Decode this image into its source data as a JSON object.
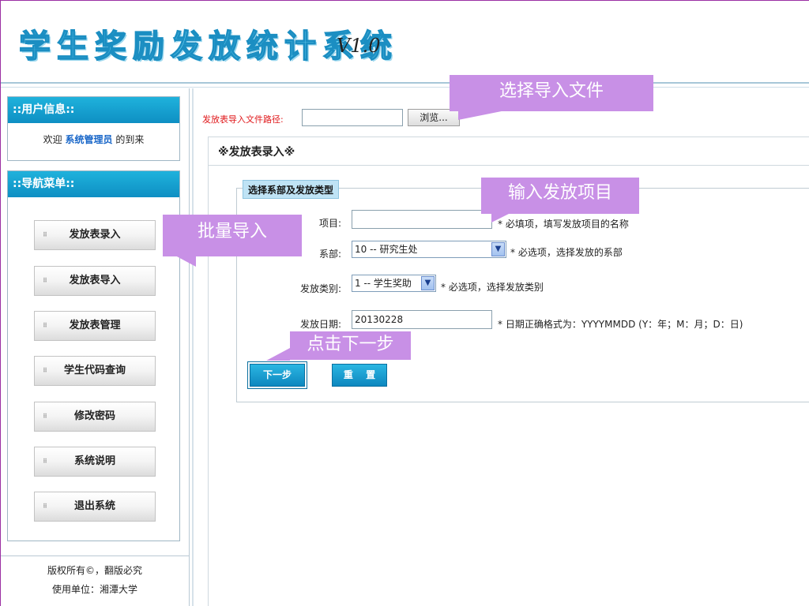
{
  "header": {
    "title": "学生奖励发放统计系统",
    "version": "V1.0"
  },
  "sidebar": {
    "user_panel_title": "::用户信息::",
    "welcome_prefix": "欢迎",
    "user_name": "系统管理员",
    "welcome_suffix": "的到来",
    "nav_panel_title": "::导航菜单::",
    "items": [
      {
        "label": "发放表录入"
      },
      {
        "label": "发放表导入"
      },
      {
        "label": "发放表管理"
      },
      {
        "label": "学生代码查询"
      },
      {
        "label": "修改密码"
      },
      {
        "label": "系统说明"
      },
      {
        "label": "退出系统"
      }
    ],
    "copyright_line1": "版权所有©，翻版必究",
    "copyright_line2": "使用单位：湘潭大学"
  },
  "import": {
    "label": "发放表导入文件路径:",
    "file_value": "",
    "browse_label": "浏览..."
  },
  "section": {
    "title": "※发放表录入※",
    "legend": "选择系部及发放类型"
  },
  "form": {
    "project_label": "项目:",
    "project_value": "",
    "project_hint": "* 必填项，填写发放项目的名称",
    "dept_label": "系部:",
    "dept_value": "10 -- 研究生处",
    "dept_hint": "* 必选项，选择发放的系部",
    "type_label": "发放类别:",
    "type_value": "1 -- 学生奖助",
    "type_hint": "* 必选项，选择发放类别",
    "date_label": "发放日期:",
    "date_value": "20130228",
    "date_hint": "* 日期正确格式为：YYYYMMDD (Y：年；M：月；D：日)",
    "next_label": "下一步",
    "reset_label": "重 置"
  },
  "callouts": {
    "select_file": "选择导入文件",
    "input_project": "输入发放项目",
    "batch_import": "批量导入",
    "click_next": "点击下一步"
  },
  "colors": {
    "accent": "#0e8fc3",
    "callout": "#c890e6",
    "required_label": "#e0181b"
  }
}
